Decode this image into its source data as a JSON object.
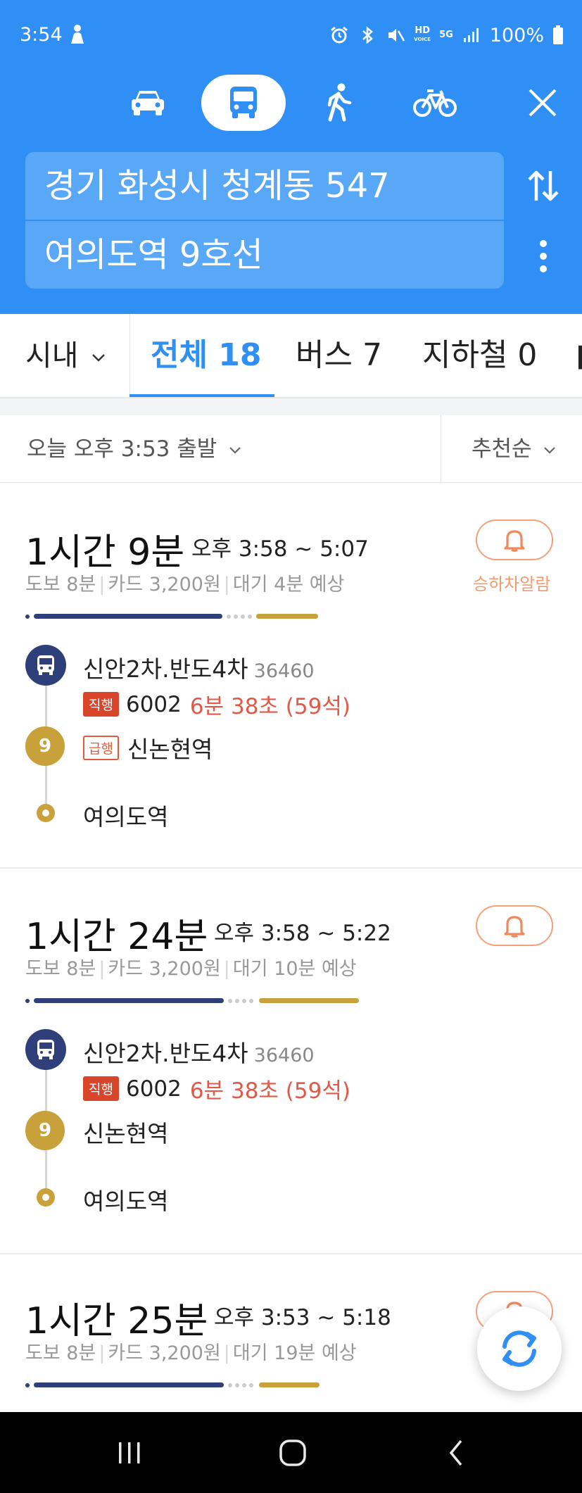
{
  "status_bar": {
    "time": "3:54",
    "battery": "100%",
    "hd_label": "HD",
    "voice_label": "VOICE",
    "fiveg_label": "5G"
  },
  "modes": [
    "car",
    "bus",
    "walk",
    "bike"
  ],
  "route": {
    "from": "경기 화성시 청계동 547",
    "to": "여의도역 9호선"
  },
  "tabs": {
    "city": "시내",
    "all": "전체 18",
    "bus": "버스 7",
    "subway": "지하철 0"
  },
  "filter": {
    "departure": "오늘 오후 3:53 출발",
    "sort": "추천순"
  },
  "routes": [
    {
      "duration": "1시간 9분",
      "time_range": "오후 3:58 ~ 5:07",
      "walk": "도보 8분",
      "fare": "카드 3,200원",
      "wait": "대기 4분 예상",
      "alarm_label": "승하차알람",
      "steps": {
        "bus_stop": "신안2차.반도4차",
        "bus_stop_id": "36460",
        "bus_tag": "직행",
        "bus_number": "6002",
        "bus_arrival": "6분 38초 (59석)",
        "subway_line": "9",
        "subway_tag": "급행",
        "subway_station": "신논현역",
        "destination": "여의도역"
      }
    },
    {
      "duration": "1시간 24분",
      "time_range": "오후 3:58 ~ 5:22",
      "walk": "도보 8분",
      "fare": "카드 3,200원",
      "wait": "대기 10분 예상",
      "steps": {
        "bus_stop": "신안2차.반도4차",
        "bus_stop_id": "36460",
        "bus_tag": "직행",
        "bus_number": "6002",
        "bus_arrival": "6분 38초 (59석)",
        "subway_line": "9",
        "subway_station": "신논현역",
        "destination": "여의도역"
      }
    },
    {
      "duration": "1시간 25분",
      "time_range": "오후 3:53 ~ 5:18",
      "walk": "도보 8분",
      "fare": "카드 3,200원",
      "wait": "대기 19분 예상"
    }
  ],
  "colors": {
    "header_blue": "#2f8ff5",
    "field_blue": "#59a8f8",
    "bus_navy": "#2f3f7a",
    "subway_gold": "#c9a13b",
    "alarm_orange": "#f39a6e",
    "arrival_red": "#e05a4a"
  }
}
